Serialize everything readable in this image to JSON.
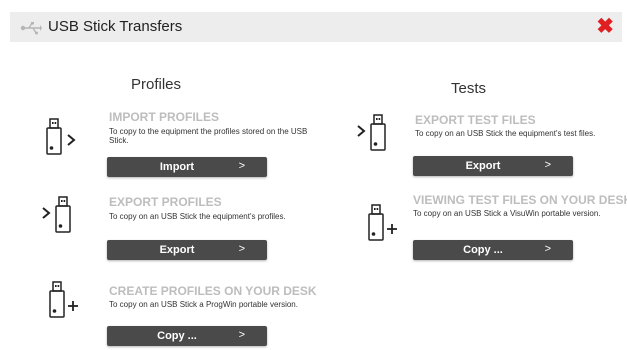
{
  "window": {
    "title": "USB Stick Transfers",
    "close_icon": "close-x-icon",
    "title_icon": "usb-icon"
  },
  "profiles": {
    "heading": "Profiles",
    "import": {
      "title": "IMPORT PROFILES",
      "desc": "To copy to the equipment the profiles stored on the USB Stick.",
      "button": "Import",
      "chevron": ">"
    },
    "export": {
      "title": "EXPORT PROFILES",
      "desc": "To copy on an USB Stick the equipment's profiles.",
      "button": "Export",
      "chevron": ">"
    },
    "create": {
      "title": "CREATE PROFILES ON YOUR DESK",
      "desc": "To copy on an USB Stick a ProgWin portable version.",
      "button": "Copy ...",
      "chevron": ">"
    }
  },
  "tests": {
    "heading": "Tests",
    "export": {
      "title": "EXPORT TEST FILES",
      "desc": "To copy on an USB Stick the equipment's test files.",
      "button": "Export",
      "chevron": ">"
    },
    "view": {
      "title": "VIEWING TEST FILES ON YOUR DESK",
      "desc": "To copy on an USB Stick a VisuWin portable version.",
      "button": "Copy ...",
      "chevron": ">"
    }
  },
  "icons": {
    "import": "usb-stick-import-icon",
    "export": "usb-stick-export-icon",
    "create": "usb-stick-plus-icon",
    "tests_export": "usb-stick-export-icon",
    "tests_view": "usb-stick-plus-icon"
  },
  "colors": {
    "close": "#e02020",
    "button": "#4a4a4a",
    "title_bar": "#ededed",
    "item_title": "#bdbdbd"
  }
}
